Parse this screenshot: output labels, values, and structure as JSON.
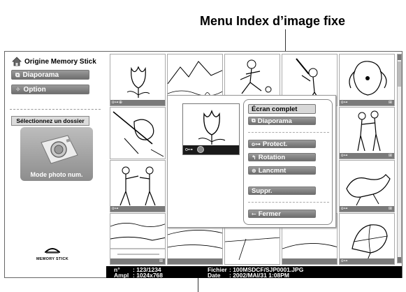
{
  "callout": {
    "title": "Menu Index d’image fixe"
  },
  "left_panel": {
    "origin_label": "Origine Memory Stick",
    "diaporama_label": "Diaporama",
    "option_label": "Option",
    "select_folder_label": "Sélectionnez un dossier",
    "mode_label": "Mode photo num.",
    "logo_text": "MEMORY STICK"
  },
  "thumbnails": [
    {
      "subject": "tulip",
      "lock": "o⊶",
      "protect": "⊕",
      "print": ""
    },
    {
      "subject": "mountains",
      "lock": "",
      "protect": "",
      "print": ""
    },
    {
      "subject": "soccer",
      "lock": "",
      "protect": "",
      "print": ""
    },
    {
      "subject": "baseball",
      "lock": "",
      "protect": "",
      "print": ""
    },
    {
      "subject": "dog",
      "lock": "o⊶",
      "protect": "",
      "print": "⊞"
    },
    {
      "subject": "skier",
      "lock": "",
      "protect": "",
      "print": ""
    },
    {
      "subject": "couple",
      "lock": "o⊶",
      "protect": "",
      "print": "⊞"
    },
    {
      "subject": "boxers",
      "lock": "o⊶",
      "protect": "",
      "print": ""
    },
    {
      "subject": "dog-run",
      "lock": "o⊶",
      "protect": "",
      "print": "⊞"
    },
    {
      "subject": "lake",
      "lock": "",
      "protect": "",
      "print": "⊞"
    },
    {
      "subject": "flower",
      "lock": "o⊶",
      "protect": "",
      "print": ""
    }
  ],
  "menu": {
    "items": [
      {
        "label": "Écran complet",
        "icon": ""
      },
      {
        "label": "Diaporama",
        "icon": "slideshow-icon"
      },
      {
        "label": "Protect.",
        "icon": "key-icon"
      },
      {
        "label": "Rotation",
        "icon": "rotate-icon"
      },
      {
        "label": "Lancmnt",
        "icon": "launch-icon"
      },
      {
        "label": "Suppr.",
        "icon": ""
      },
      {
        "label": "Fermer",
        "icon": "close-arrow-icon"
      }
    ]
  },
  "preview": {
    "lock": "o⊶"
  },
  "info": {
    "number_label": "n°",
    "number_value": ": 123/1234",
    "size_label": "Ampl",
    "size_value": ": 1024x768",
    "file_label": "Fichier",
    "file_value": ": 100MSDCF/SJP0001.JPG",
    "date_label": "Date",
    "date_value": ": 2002/MAI/31 1:08PM"
  }
}
